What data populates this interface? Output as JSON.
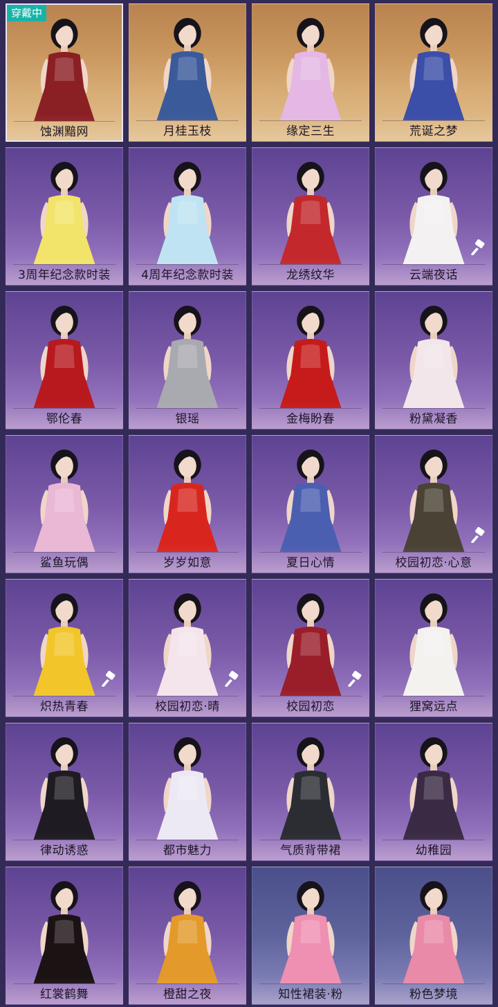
{
  "equipped_badge": "穿戴中",
  "outfits": [
    {
      "name": "蚀渊黯网",
      "bg": "gold",
      "equipped": true,
      "dye": false,
      "color": "#8a1f24"
    },
    {
      "name": "月桂玉枝",
      "bg": "gold",
      "equipped": false,
      "dye": false,
      "color": "#3a5a9a"
    },
    {
      "name": "缘定三生",
      "bg": "gold",
      "equipped": false,
      "dye": false,
      "color": "#e4b7e4"
    },
    {
      "name": "荒诞之梦",
      "bg": "gold",
      "equipped": false,
      "dye": false,
      "color": "#3b4ea8"
    },
    {
      "name": "3周年纪念款时装",
      "bg": "purple",
      "equipped": false,
      "dye": false,
      "color": "#f2e46a"
    },
    {
      "name": "4周年纪念款时装",
      "bg": "purple",
      "equipped": false,
      "dye": false,
      "color": "#bfe3f2"
    },
    {
      "name": "龙绣纹华",
      "bg": "purple",
      "equipped": false,
      "dye": false,
      "color": "#c3282c"
    },
    {
      "name": "云端夜话",
      "bg": "purple",
      "equipped": false,
      "dye": true,
      "color": "#f3f1f1"
    },
    {
      "name": "鄂伦春",
      "bg": "purple",
      "equipped": false,
      "dye": false,
      "color": "#b8191f"
    },
    {
      "name": "银瑶",
      "bg": "purple",
      "equipped": false,
      "dye": false,
      "color": "#a9a9b0"
    },
    {
      "name": "金梅盼春",
      "bg": "purple",
      "equipped": false,
      "dye": false,
      "color": "#c61b1b"
    },
    {
      "name": "粉黛凝香",
      "bg": "purple",
      "equipped": false,
      "dye": false,
      "color": "#f2e6ea"
    },
    {
      "name": "鲨鱼玩偶",
      "bg": "purple",
      "equipped": false,
      "dye": false,
      "color": "#e9b8d4"
    },
    {
      "name": "岁岁如意",
      "bg": "purple",
      "equipped": false,
      "dye": false,
      "color": "#d8261f"
    },
    {
      "name": "夏日心情",
      "bg": "purple",
      "equipped": false,
      "dye": false,
      "color": "#4b5fb0"
    },
    {
      "name": "校园初恋·心意",
      "bg": "purple",
      "equipped": false,
      "dye": true,
      "color": "#4a4235"
    },
    {
      "name": "炽热青春",
      "bg": "purple",
      "equipped": false,
      "dye": true,
      "color": "#f2c62a"
    },
    {
      "name": "校园初恋·晴",
      "bg": "purple",
      "equipped": false,
      "dye": true,
      "color": "#f4e4ec"
    },
    {
      "name": "校园初恋",
      "bg": "purple",
      "equipped": false,
      "dye": true,
      "color": "#9a1e2a"
    },
    {
      "name": "狸窝远点",
      "bg": "purple",
      "equipped": false,
      "dye": false,
      "color": "#f4f2ef"
    },
    {
      "name": "律动诱惑",
      "bg": "purple",
      "equipped": false,
      "dye": false,
      "color": "#1e1b22"
    },
    {
      "name": "都市魅力",
      "bg": "purple",
      "equipped": false,
      "dye": false,
      "color": "#ede9f4"
    },
    {
      "name": "气质背带裙",
      "bg": "purple",
      "equipped": false,
      "dye": false,
      "color": "#2b2d33"
    },
    {
      "name": "幼稚园",
      "bg": "purple",
      "equipped": false,
      "dye": false,
      "color": "#3a2a44"
    },
    {
      "name": "红裳鹤舞",
      "bg": "purple",
      "equipped": false,
      "dye": false,
      "color": "#1b1214"
    },
    {
      "name": "橙甜之夜",
      "bg": "purple",
      "equipped": false,
      "dye": false,
      "color": "#e39a2a"
    },
    {
      "name": "知性裙装·粉",
      "bg": "blue",
      "equipped": false,
      "dye": false,
      "color": "#ef8fb2"
    },
    {
      "name": "粉色梦境",
      "bg": "blue",
      "equipped": false,
      "dye": false,
      "color": "#e98aa8"
    }
  ]
}
